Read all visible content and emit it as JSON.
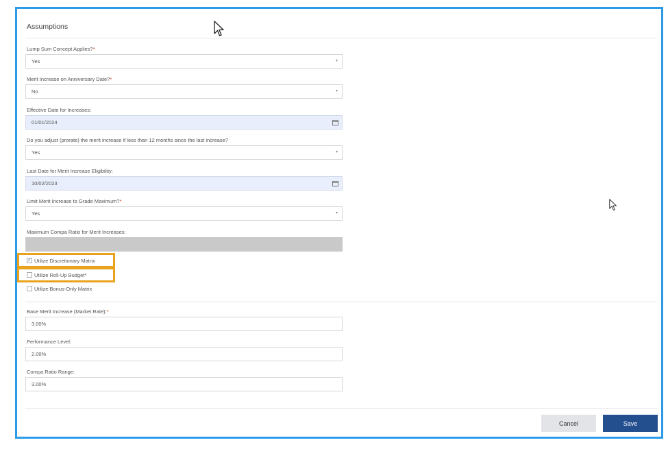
{
  "section_title": "Assumptions",
  "fields": {
    "lump_sum": {
      "label": "Lump Sum Concept Applies?",
      "required_mark": "*",
      "value": "Yes"
    },
    "merit_anniversary": {
      "label": "Merit Increase on Anniversary Date?",
      "required_mark": "*",
      "value": "No"
    },
    "effective_date": {
      "label": "Effective Date for Increases:",
      "value": "01/01/2024"
    },
    "prorate": {
      "label": "Do you adjust (prorate) the merit increase if less than 12 months since the last increase?",
      "value": "Yes"
    },
    "last_eligibility": {
      "label": "Last Date for Merit Increase Eligibility:",
      "value": "10/02/2023"
    },
    "limit_grade_max": {
      "label": "Limit Merit Increase to Grade Maximum?",
      "required_mark": "*",
      "value": "Yes"
    },
    "max_compa_ratio": {
      "label": "Maximum Compa Ratio for Merit Increases:",
      "value": ""
    },
    "base_merit": {
      "label": "Base Merit Increase (Market Rate):",
      "required_mark": "*",
      "value": "3.00%"
    },
    "performance_level": {
      "label": "Performance Level:",
      "value": "2.00%"
    },
    "compa_ratio_range": {
      "label": "Compa Ratio Range:",
      "value": "3.00%"
    }
  },
  "checkboxes": {
    "discretionary_matrix": {
      "label": "Utilize Discretionary Matrix",
      "checked": true,
      "mark": "✓"
    },
    "rollup_budget": {
      "label": "Utilize Roll-Up Budget",
      "required_mark": "*",
      "checked": false
    },
    "bonus_only_matrix": {
      "label": "Utilize Bonus-Only Matrix",
      "checked": false
    }
  },
  "buttons": {
    "cancel": "Cancel",
    "save": "Save"
  },
  "icons": {
    "dropdown": "▾",
    "calendar": "calendar-icon"
  },
  "colors": {
    "accent_border": "#2b9be8",
    "highlight": "#e8a21c",
    "save_button": "#244f8f",
    "required": "#e0301e"
  }
}
